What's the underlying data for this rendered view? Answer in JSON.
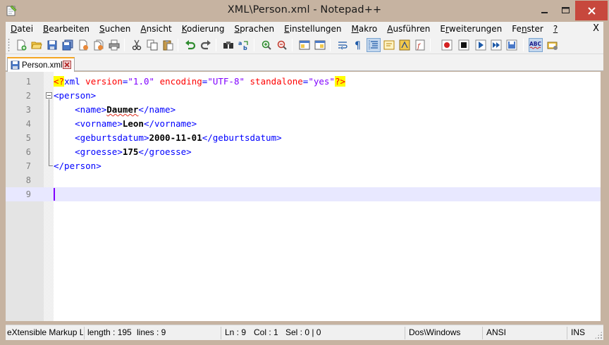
{
  "window": {
    "title": "XML\\Person.xml - Notepad++",
    "min_icon": "minimize-icon",
    "max_icon": "maximize-icon",
    "close_icon": "close-icon"
  },
  "menu": {
    "items": [
      {
        "label": "Datei",
        "u": "D",
        "rest": "atei"
      },
      {
        "label": "Bearbeiten",
        "u": "B",
        "rest": "earbeiten"
      },
      {
        "label": "Suchen",
        "u": "S",
        "rest": "uchen"
      },
      {
        "label": "Ansicht",
        "u": "A",
        "rest": "nsicht"
      },
      {
        "label": "Kodierung",
        "u": "K",
        "rest": "odierung"
      },
      {
        "label": "Sprachen",
        "u": "S",
        "rest": "prachen"
      },
      {
        "label": "Einstellungen",
        "u": "E",
        "rest": "instellungen"
      },
      {
        "label": "Makro",
        "u": "M",
        "rest": "akro"
      },
      {
        "label": "Ausführen",
        "u": "A",
        "rest": "usführen"
      },
      {
        "label": "Erweiterungen",
        "pre": "E",
        "u": "r",
        "rest": "weiterungen"
      },
      {
        "label": "Fenster",
        "pre": "Fe",
        "u": "n",
        "rest": "ster"
      },
      {
        "label": "?",
        "u": "?",
        "rest": ""
      }
    ],
    "close_label": "X"
  },
  "toolbar": {
    "icons": [
      "new-file-icon",
      "open-file-icon",
      "save-icon",
      "save-all-icon",
      "close-icon",
      "close-all-icon",
      "print-icon",
      "cut-icon",
      "copy-icon",
      "paste-icon",
      "undo-icon",
      "redo-icon",
      "find-icon",
      "replace-icon",
      "zoom-in-icon",
      "zoom-out-icon",
      "sync-vertical-icon",
      "sync-horizontal-icon",
      "word-wrap-icon",
      "show-all-chars-icon",
      "indent-guide-icon",
      "user-language-icon",
      "doc-map-icon",
      "function-list-icon",
      "record-macro-icon",
      "stop-record-icon",
      "play-macro-icon",
      "run-macro-multiple-icon",
      "save-macro-icon",
      "spellcheck-icon",
      "clipboard-history-icon"
    ]
  },
  "tabs": [
    {
      "label": "Person.xml",
      "icon": "saved-file-icon",
      "close_icon": "tab-close-icon"
    }
  ],
  "editor": {
    "lines": [
      {
        "num": "1"
      },
      {
        "num": "2"
      },
      {
        "num": "3"
      },
      {
        "num": "4"
      },
      {
        "num": "5"
      },
      {
        "num": "6"
      },
      {
        "num": "7"
      },
      {
        "num": "8"
      },
      {
        "num": "9"
      }
    ],
    "xml": {
      "pi_open": "<?",
      "pi_name": "xml",
      "attr1": "version",
      "val1": "\"1.0\"",
      "attr2": "encoding",
      "val2": "\"UTF-8\"",
      "attr3": "standalone",
      "val3": "\"yes\"",
      "pi_close": "?>",
      "person_open": "<person>",
      "person_close": "</person>",
      "name_open": "<name>",
      "name_val": "Daumer",
      "name_close": "</name>",
      "vorname_open": "<vorname>",
      "vorname_val": "Leon",
      "vorname_close": "</vorname>",
      "geb_open": "<geburtsdatum>",
      "geb_val": "2000-11-01",
      "geb_close": "</geburtsdatum>",
      "groesse_open": "<groesse>",
      "groesse_val": "175",
      "groesse_close": "</groesse>"
    },
    "current_line": 9
  },
  "status": {
    "language": "eXtensible Markup L",
    "length": "length : 195",
    "lines": "lines : 9",
    "ln": "Ln : 9",
    "col": "Col : 1",
    "sel": "Sel : 0 | 0",
    "eol": "Dos\\Windows",
    "encoding": "ANSI",
    "mode": "INS"
  }
}
